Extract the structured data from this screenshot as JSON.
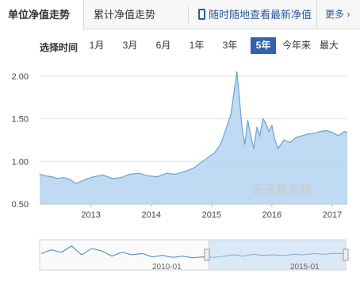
{
  "tabs": {
    "unit_nav": "单位净值走势",
    "cumulative_nav": "累计净值走势",
    "mobile": "随时随地查看最新净值",
    "more": "更多"
  },
  "range": {
    "label": "选择时间",
    "options": [
      "1月",
      "3月",
      "6月",
      "1年",
      "3年",
      "5年",
      "今年来",
      "最大"
    ],
    "selected": "5年"
  },
  "watermark": "天天基金网",
  "navigator": {
    "labels": [
      "2010-01",
      "2015-01"
    ]
  },
  "colors": {
    "line": "#6aa3d8",
    "fill": "#a9cdee",
    "active": "#2f63b0"
  },
  "chart_data": {
    "type": "area",
    "x_ticks": [
      "2013",
      "2014",
      "2015",
      "2016",
      "2017"
    ],
    "y_ticks": [
      "0.50",
      "1.00",
      "1.50",
      "2.00"
    ],
    "ylim": [
      0.5,
      2.1
    ],
    "xlim": [
      2012.15,
      2017.25
    ],
    "grid": true,
    "series": [
      {
        "x": [
          2012.15,
          2012.25,
          2012.35,
          2012.45,
          2012.55,
          2012.65,
          2012.75,
          2012.85,
          2012.95,
          2013.05,
          2013.2,
          2013.35,
          2013.5,
          2013.65,
          2013.8,
          2013.95,
          2014.1,
          2014.25,
          2014.4,
          2014.55,
          2014.7,
          2014.85,
          2014.95,
          2015.05,
          2015.15,
          2015.25,
          2015.32,
          2015.38,
          2015.42,
          2015.46,
          2015.5,
          2015.55,
          2015.6,
          2015.65,
          2015.7,
          2015.75,
          2015.8,
          2015.85,
          2015.9,
          2015.95,
          2016.0,
          2016.05,
          2016.1,
          2016.2,
          2016.3,
          2016.4,
          2016.5,
          2016.6,
          2016.7,
          2016.8,
          2016.9,
          2017.0,
          2017.1,
          2017.2,
          2017.25
        ],
        "values": [
          0.85,
          0.83,
          0.82,
          0.8,
          0.81,
          0.79,
          0.74,
          0.77,
          0.8,
          0.82,
          0.84,
          0.8,
          0.81,
          0.85,
          0.86,
          0.83,
          0.82,
          0.86,
          0.85,
          0.88,
          0.92,
          1.0,
          1.05,
          1.1,
          1.2,
          1.4,
          1.55,
          1.85,
          2.05,
          1.75,
          1.42,
          1.2,
          1.48,
          1.3,
          1.15,
          1.4,
          1.3,
          1.5,
          1.45,
          1.35,
          1.42,
          1.25,
          1.15,
          1.25,
          1.22,
          1.28,
          1.3,
          1.32,
          1.33,
          1.35,
          1.36,
          1.34,
          1.3,
          1.35,
          1.34
        ]
      }
    ]
  }
}
